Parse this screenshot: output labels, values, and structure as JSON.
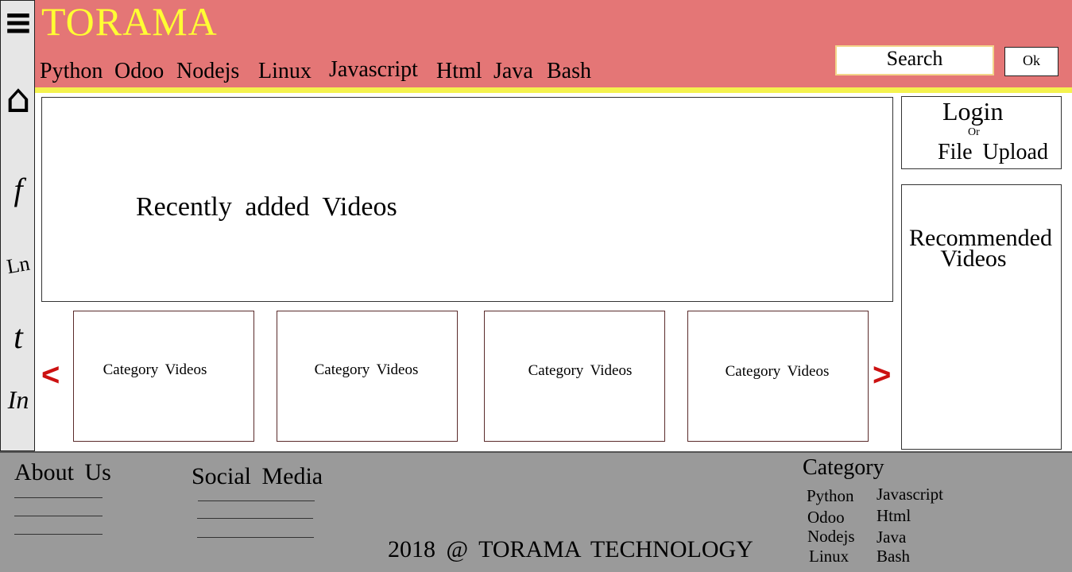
{
  "sidebar": {
    "menu_icon": "≡",
    "home_icon": "⌂",
    "facebook": "f",
    "linkedin": "Ln",
    "twitter": "t",
    "instagram": "In"
  },
  "header": {
    "brand": "TORAMA",
    "nav": [
      "Python",
      "Odoo",
      "Nodejs",
      "Linux",
      "Javascript",
      "Html",
      "Java",
      "Bash"
    ],
    "search_label": "Search",
    "ok_label": "Ok"
  },
  "main": {
    "recent_title": "Recently added Videos",
    "login": "Login",
    "or": "Or",
    "upload": "File Upload",
    "recommended_line1": "Recommended",
    "recommended_line2": "Videos",
    "categories": [
      "Category Videos",
      "Category Videos",
      "Category Videos",
      "Category Videos"
    ],
    "prev": "<",
    "next": ">"
  },
  "footer": {
    "about": "About Us",
    "social": "Social Media",
    "category_title": "Category",
    "category_col1": [
      "Python",
      "Odoo",
      "Nodejs",
      "Linux"
    ],
    "category_col2": [
      "Javascript",
      "Html",
      "Java",
      "Bash"
    ],
    "copyright": "2018 @ TORAMA TECHNOLOGY"
  },
  "colors": {
    "header": "#e47676",
    "brand": "#ffff33",
    "accent_line": "#f4f24e",
    "footer": "#9a9a9a",
    "arrows": "#cc1111"
  }
}
